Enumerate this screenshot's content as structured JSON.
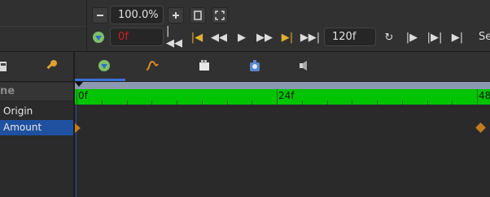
{
  "toolbar": {
    "zoom_value": "100.0%",
    "frame_value": "0f",
    "end_frame_value": "120f",
    "truncated_label": "Se"
  },
  "colors": {
    "ruler_green": "#00c400",
    "selection_blue": "#2050a0",
    "current_frame_red": "#d02020",
    "keyframe_orange": "#c07a20"
  },
  "params_panel": {
    "header_label": "ne",
    "rows": [
      {
        "label": "Origin"
      },
      {
        "label": "Amount"
      }
    ]
  },
  "timeline": {
    "ruler_labels": [
      "0f",
      "24f",
      "48"
    ],
    "tabs": [
      "params-tab-icon",
      "curves-tab-icon",
      "keyframes-tab-icon",
      "library-tab-icon",
      "sound-tab-icon"
    ]
  }
}
